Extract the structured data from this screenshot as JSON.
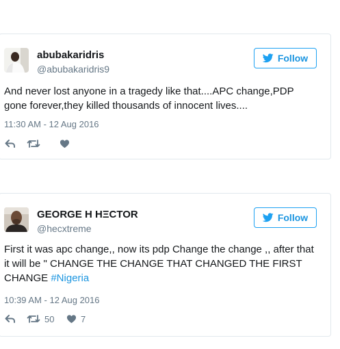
{
  "tweets": [
    {
      "display_name": "abubakaridris",
      "handle": "@abubakaridris9",
      "follow_label": "Follow",
      "text": "And never lost anyone in a tragedy like that....APC change,PDP gone forever,they killed thousands of innocent lives....",
      "timestamp": "11:30 AM - 12 Aug 2016",
      "retweets": "",
      "likes": ""
    },
    {
      "display_name": "GEORGE H HΞCTOR",
      "handle": "@hecxtreme",
      "follow_label": "Follow",
      "text": "First it was apc change,, now its pdp Change the change ,, after that it will be \" CHANGE THE CHANGE THAT CHANGED THE FIRST CHANGE ",
      "hashtag": "#Nigeria",
      "timestamp": "10:39 AM - 12 Aug 2016",
      "retweets": "50",
      "likes": "7"
    }
  ],
  "icons": {
    "follow": "twitter-bird-icon",
    "reply": "reply-icon",
    "retweet": "retweet-icon",
    "like": "heart-icon"
  },
  "colors": {
    "accent": "#1da1f2",
    "link": "#1b95e0",
    "muted": "#657786",
    "border": "#e1e8ed"
  }
}
